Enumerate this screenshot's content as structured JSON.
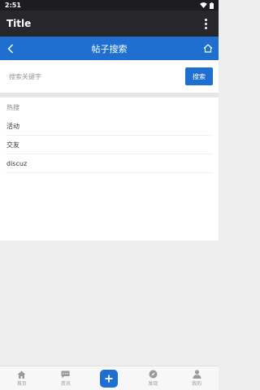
{
  "status_bar": {
    "time": "2:51"
  },
  "app_bar": {
    "title": "Title"
  },
  "nav_bar": {
    "title": "帖子搜索"
  },
  "search": {
    "placeholder": "搜索关键字",
    "button_label": "搜索"
  },
  "hot": {
    "title": "热搜",
    "items": [
      "活动",
      "交友",
      "discuz"
    ]
  },
  "tabbar": {
    "items": [
      {
        "label": "首页",
        "icon": "home-icon"
      },
      {
        "label": "资讯",
        "icon": "chat-icon"
      },
      {
        "label": "",
        "icon": "plus-icon"
      },
      {
        "label": "发现",
        "icon": "compass-icon"
      },
      {
        "label": "我的",
        "icon": "user-icon"
      }
    ]
  },
  "colors": {
    "primary": "#1e6fd0",
    "appbar": "#26262b",
    "statusbar": "#1d1d1f"
  }
}
